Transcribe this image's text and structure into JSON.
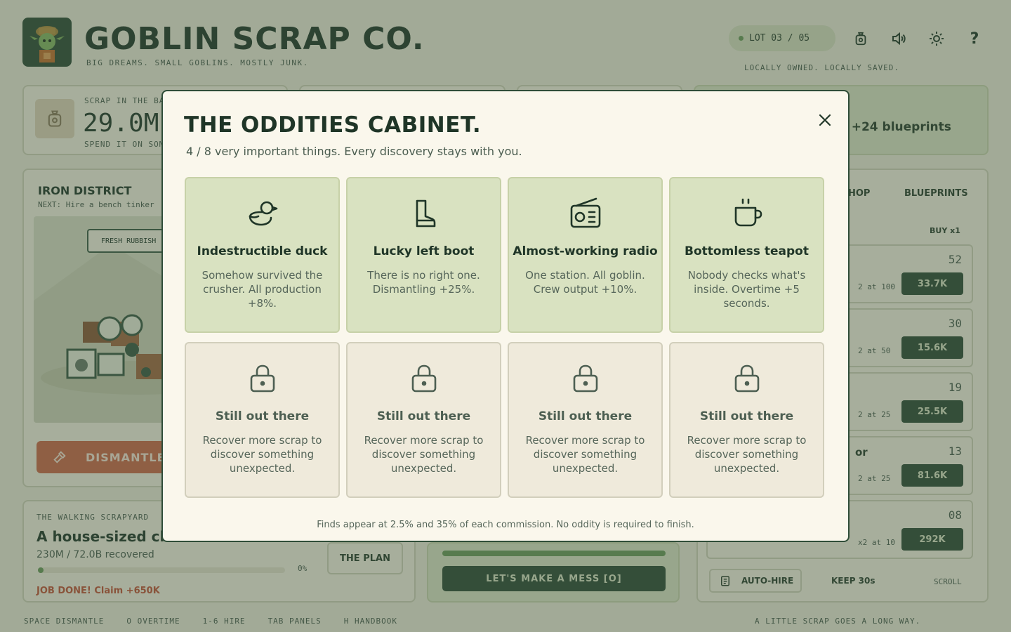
{
  "app": {
    "title": "GOBLIN SCRAP CO.",
    "tagline": "BIG DREAMS. SMALL GOBLINS. MOSTLY JUNK.",
    "lot": "LOT 03 / 05",
    "owned": "LOCALLY OWNED. LOCALLY SAVED.",
    "help": "?"
  },
  "bank": {
    "label": "SCRAP IN THE BANK",
    "value": "29.0M",
    "sub": "SPEND IT ON SOME"
  },
  "blueprints_banner": ": +24 blueprints",
  "district": {
    "title": "IRON DISTRICT",
    "next": "NEXT: Hire a bench tinker",
    "fresh_tag": "FRESH RUBBISH",
    "dismantle_label": "DISMANTLE"
  },
  "job": {
    "label": "THE WALKING SCRAPYARD",
    "title": "A house-sized ch",
    "progress": "230M / 72.0B recovered",
    "percent_value": 0.003,
    "percent_label": "0%",
    "plan_label": "THE PLAN",
    "done": "JOB DONE! Claim +650K"
  },
  "mess": {
    "button": "LET'S MAKE A MESS   [O]"
  },
  "shop": {
    "tabs": [
      "HOP",
      "BLUEPRINTS"
    ],
    "buy": "BUY x1",
    "items": [
      {
        "name": "",
        "count": "52",
        "note": "2 at 100",
        "price": "33.7K"
      },
      {
        "name": "",
        "count": "30",
        "note": "2 at 50",
        "price": "15.6K"
      },
      {
        "name": "",
        "count": "19",
        "note": "2 at 25",
        "price": "25.5K"
      },
      {
        "name": "or",
        "count": "13",
        "note": "2 at 25",
        "price": "81.6K"
      },
      {
        "name": "",
        "count": "08",
        "note": "x2 at 10",
        "price": "292K"
      }
    ],
    "auto_hire": "AUTO-HIRE",
    "keep": "KEEP 30s",
    "scroll": "SCROLL"
  },
  "shortcuts": [
    "SPACE  DISMANTLE",
    "O  OVERTIME",
    "1-6  HIRE",
    "TAB  PANELS",
    "H  HANDBOOK"
  ],
  "footer_tag": "A LITTLE SCRAP GOES A LONG WAY.",
  "modal": {
    "title": "THE ODDITIES CABINET.",
    "subtitle": "4 / 8 very important things. Every discovery stays with you.",
    "footer": "Finds appear at 2.5% and 35% of each commission. No oddity is required to finish.",
    "cards": [
      {
        "name": "Indestructible duck",
        "desc": "Somehow survived the crusher. All production +8%.",
        "icon": "duck-icon",
        "locked": false
      },
      {
        "name": "Lucky left boot",
        "desc": "There is no right one. Dismantling +25%.",
        "icon": "boot-icon",
        "locked": false
      },
      {
        "name": "Almost-working radio",
        "desc": "One station. All goblin. Crew output +10%.",
        "icon": "radio-icon",
        "locked": false
      },
      {
        "name": "Bottomless teapot",
        "desc": "Nobody checks what's inside. Overtime +5 seconds.",
        "icon": "teapot-icon",
        "locked": false
      },
      {
        "name": "Still out there",
        "desc": "Recover more scrap to discover something unexpected.",
        "icon": "lock-icon",
        "locked": true
      },
      {
        "name": "Still out there",
        "desc": "Recover more scrap to discover something unexpected.",
        "icon": "lock-icon",
        "locked": true
      },
      {
        "name": "Still out there",
        "desc": "Recover more scrap to discover something unexpected.",
        "icon": "lock-icon",
        "locked": true
      },
      {
        "name": "Still out there",
        "desc": "Recover more scrap to discover something unexpected.",
        "icon": "lock-icon",
        "locked": true
      }
    ]
  },
  "colors": {
    "accent": "#2f4d38",
    "unlocked_card": "#d9e2c1",
    "locked_card": "#efeadb",
    "danger": "#cc6a4b"
  }
}
